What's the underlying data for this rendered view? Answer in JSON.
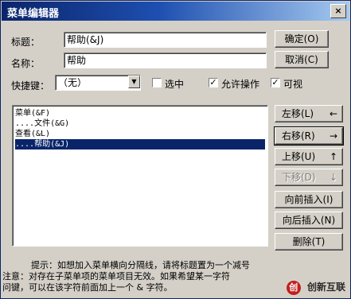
{
  "window": {
    "title": "菜单编辑器",
    "close_glyph": "×"
  },
  "form": {
    "caption_label": "标题：",
    "caption_value": "帮助(&J)",
    "name_label": "名称：",
    "name_value": "帮助",
    "shortcut_label": "快捷键：",
    "shortcut_value": "（无）",
    "checked_label": "选中",
    "enabled_label": "允许操作",
    "visible_label": "可视"
  },
  "buttons": {
    "ok": "确定(O)",
    "cancel": "取消(C)",
    "left": "左移(L)",
    "right": "右移(R)",
    "up": "上移(U)",
    "down": "下移(D)",
    "insert_before": "向前插入(I)",
    "insert_after": "向后插入(N)",
    "delete": "删除(T)",
    "left_arrow": "←",
    "right_arrow": "→",
    "up_arrow": "↑",
    "down_arrow": "↓"
  },
  "menu_items": [
    {
      "text": "菜单(&F)",
      "selected": false
    },
    {
      "text": "....文件(&G)",
      "selected": false
    },
    {
      "text": "查看(&L)",
      "selected": false
    },
    {
      "text": "....帮助(&J)",
      "selected": true
    }
  ],
  "hint": {
    "line1": "提示：如想加入菜单横向分隔线，请将标题置为一个减号",
    "line2": "注意：对存在子菜单项的菜单项目无效。如果希望某一字符",
    "line3": "问键，可以在该字符前面加上一个 & 字符。"
  },
  "watermark": {
    "logo_glyph": "创",
    "text": "创新互联"
  }
}
